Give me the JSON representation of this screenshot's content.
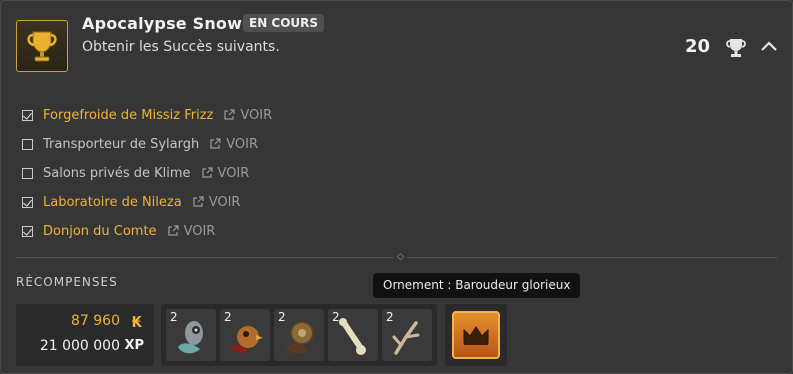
{
  "achievement": {
    "title": "Apocalypse Snow",
    "status": "EN COURS",
    "subtitle": "Obtenir les Succès suivants.",
    "points": "20",
    "icon": "trophy-icon"
  },
  "objectives": [
    {
      "label": "Forgefroide de Missiz Frizz",
      "done": true,
      "link": "VOIR"
    },
    {
      "label": "Transporteur de Sylargh",
      "done": false,
      "link": "VOIR"
    },
    {
      "label": "Salons privés de Klime",
      "done": false,
      "link": "VOIR"
    },
    {
      "label": "Laboratoire de Nileza",
      "done": true,
      "link": "VOIR"
    },
    {
      "label": "Donjon du Comte",
      "done": true,
      "link": "VOIR"
    }
  ],
  "rewards": {
    "label": "RÉCOMPENSES",
    "kamas": "87 960",
    "xp": "21 000 000",
    "xp_unit": "XP",
    "items": [
      {
        "qty": "2",
        "icon": "mask-icon"
      },
      {
        "qty": "2",
        "icon": "bird-icon"
      },
      {
        "qty": "2",
        "icon": "wood-ring-icon"
      },
      {
        "qty": "2",
        "icon": "bone-icon"
      },
      {
        "qty": "2",
        "icon": "antler-icon"
      }
    ],
    "ornament_icon": "crown-icon",
    "tooltip": "Ornement : Baroudeur glorieux"
  },
  "colors": {
    "accent": "#f0b23a",
    "background": "#363636",
    "panel": "#2a2a2a"
  }
}
